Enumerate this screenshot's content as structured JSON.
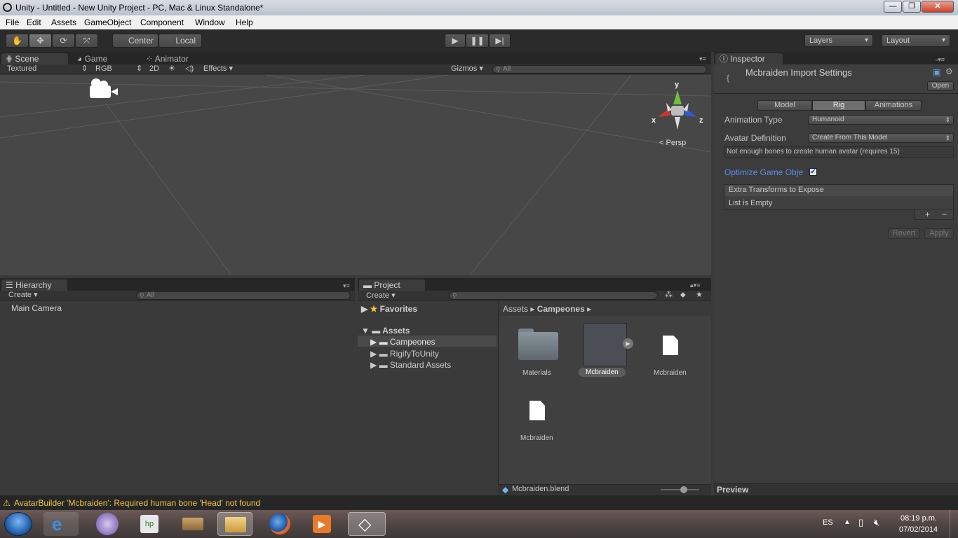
{
  "window": {
    "title": "Unity - Untitled - New Unity Project - PC, Mac & Linux Standalone*",
    "minimize": "—",
    "maximize": "❐",
    "close": "✕"
  },
  "menu": [
    "File",
    "Edit",
    "Assets",
    "GameObject",
    "Component",
    "Window",
    "Help"
  ],
  "toolbar": {
    "pivot": "Center",
    "space": "Local",
    "layers": "Layers",
    "layout": "Layout"
  },
  "scene_panel": {
    "tabs": [
      "Scene",
      "Game",
      "Animator"
    ],
    "render_mode": "Textured",
    "color_mode": "RGB",
    "mode_2d": "2D",
    "effects": "Effects",
    "gizmos": "Gizmos",
    "search_placeholder": "All",
    "gizmo_labels": {
      "y": "y",
      "x": "x",
      "z": "z"
    },
    "projection": "Persp"
  },
  "hierarchy": {
    "tab": "Hierarchy",
    "create": "Create",
    "search_placeholder": "All",
    "items": [
      "Main Camera"
    ]
  },
  "project": {
    "tab": "Project",
    "create": "Create",
    "favorites": "Favorites",
    "assets_root": "Assets",
    "folders": [
      "Campeones",
      "RigifyToUnity",
      "Standard Assets"
    ],
    "breadcrumb": [
      "Assets",
      "Campeones"
    ],
    "grid_items": [
      "Materials",
      "Mcbraiden",
      "Mcbraiden",
      "Mcbraiden"
    ],
    "footer_file": "Mcbraiden.blend"
  },
  "inspector": {
    "tab": "Inspector",
    "title": "Mcbraiden Import Settings",
    "open": "Open",
    "subtabs": [
      "Model",
      "Rig",
      "Animations"
    ],
    "animation_type_label": "Animation Type",
    "animation_type_value": "Humanoid",
    "avatar_definition_label": "Avatar Definition",
    "avatar_definition_value": "Create From This Model",
    "warning": "Not enough bones to create human avatar (requires 15)",
    "optimize_label": "Optimize Game Obje",
    "extra_transforms": "Extra Transforms to Expose",
    "list_empty": "List is Empty",
    "plus": "+",
    "minus": "−",
    "revert": "Revert",
    "apply": "Apply",
    "preview": "Preview"
  },
  "status": {
    "message": "AvatarBuilder 'Mcbraiden': Required human bone 'Head' not found"
  },
  "taskbar": {
    "language": "ES",
    "time": "08:19 p.m.",
    "date": "07/02/2014"
  },
  "colors": {
    "accent_tab": "#5a5a5a",
    "link_blue": "#5a8fe6",
    "warning_yellow": "#f4c842"
  }
}
